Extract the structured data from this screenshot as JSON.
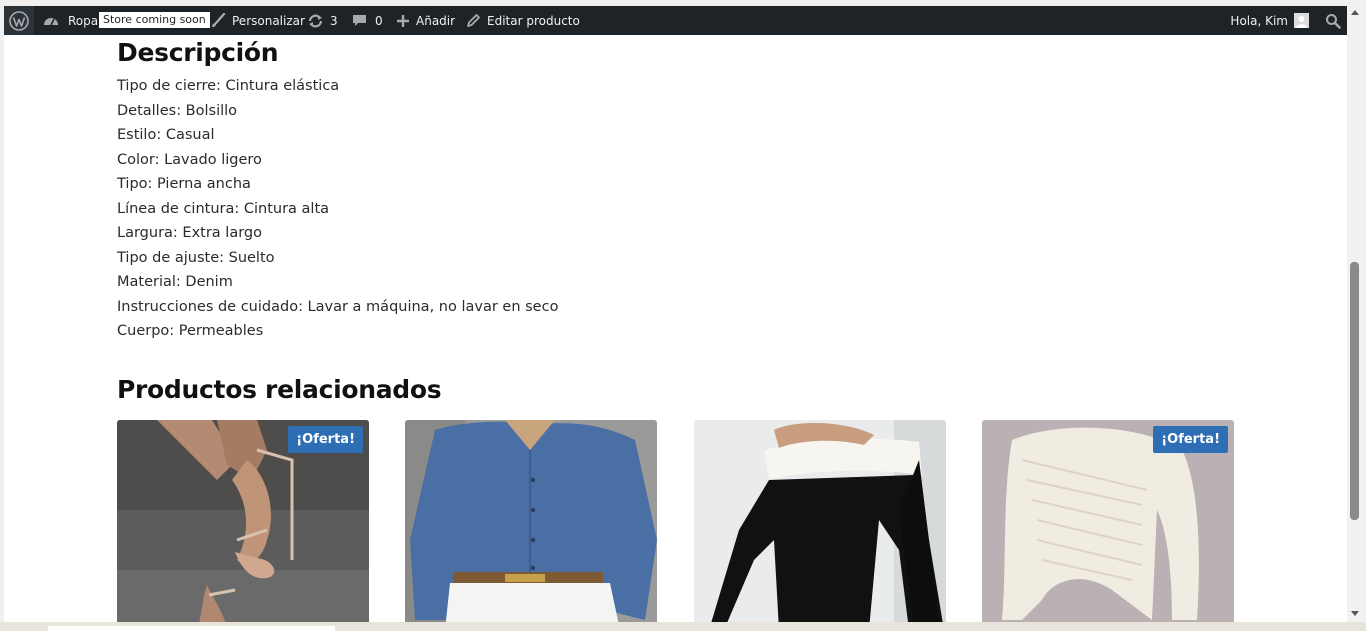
{
  "adminbar": {
    "wp_logo": "wordpress-logo",
    "site_name": "Ropa",
    "store_badge": "Store coming soon",
    "customize_label": "Personalizar",
    "updates_count": "3",
    "comments_count": "0",
    "new_label": "Añadir",
    "edit_label": "Editar producto",
    "howdy": "Hola, Kim"
  },
  "description": {
    "title": "Descripción",
    "items": [
      "Tipo de cierre: Cintura elástica",
      "Detalles: Bolsillo",
      "Estilo: Casual",
      "Color: Lavado ligero",
      "Tipo: Pierna ancha",
      "Línea de cintura: Cintura alta",
      "Largura: Extra largo",
      "Tipo de ajuste: Suelto",
      "Material: Denim",
      "Instrucciones de cuidado: Lavar a máquina, no lavar en seco",
      "Cuerpo: Permeables"
    ]
  },
  "related": {
    "title": "Productos relacionados",
    "products": [
      {
        "image": "nude-heeled-sandals",
        "sale_badge": "¡Oferta!"
      },
      {
        "image": "blue-denim-shirt",
        "sale_badge": ""
      },
      {
        "image": "black-white-off-shoulder-dress",
        "sale_badge": ""
      },
      {
        "image": "cream-knit-asymmetric-top",
        "sale_badge": "¡Oferta!"
      }
    ]
  },
  "colors": {
    "adminbar_bg": "#1d2327",
    "sale_badge": "#2e6eb5"
  }
}
